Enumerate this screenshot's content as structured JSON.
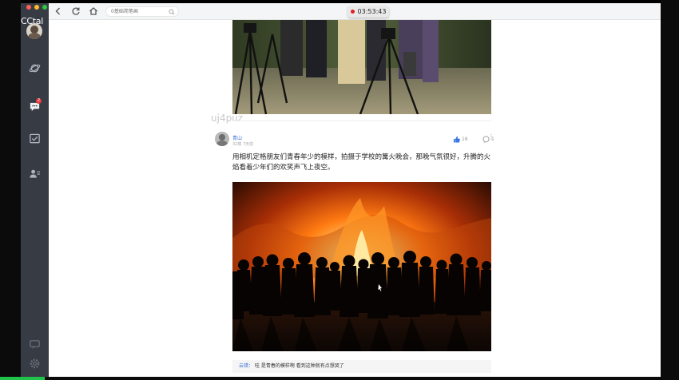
{
  "app": {
    "name": "CCtal",
    "message_badge": "2"
  },
  "toolbar": {
    "search_placeholder": "0基础简笔画",
    "timer": "03:53:43"
  },
  "content": {
    "watermark": "uj4puz",
    "post": {
      "author": "青山",
      "meta": "32楼 7天前",
      "likes": "16",
      "comments": "1",
      "more": "⋮",
      "text": "用相机定格朋友们青春年少的模样，拍摄于学校的篝火晚会，那晚气氛很好，升腾的火焰看着少年们的欢笑声飞上夜空。",
      "comment_author": "云错：",
      "comment_text": "哇 是青春的模样啊 看到这种就有点想哭了"
    }
  },
  "colors": {
    "sidebar_bg": "#363b44",
    "link_blue": "#3a6fd8",
    "like_blue": "#3a76e0",
    "fire_core": "#ffe27a",
    "fire_mid": "#ff7a12"
  },
  "icons": {
    "back": "chevron-left-icon",
    "refresh": "refresh-icon",
    "home": "home-icon",
    "search": "search-icon",
    "planet": "planet-icon",
    "message": "message-icon",
    "inbox": "inbox-icon",
    "contacts": "contacts-icon",
    "feedback": "feedback-icon",
    "settings": "gear-icon",
    "share": "share-icon",
    "like": "thumbs-up-icon",
    "comment": "comment-icon"
  }
}
